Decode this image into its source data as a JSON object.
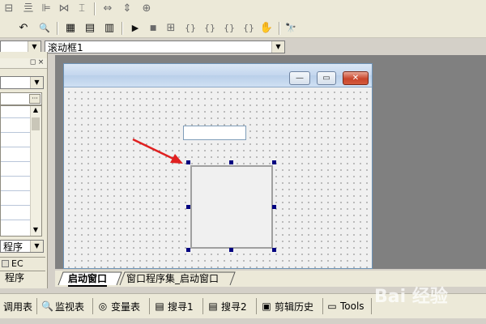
{
  "toolbar1": {
    "buttons": [
      {
        "name": "form-layout-icon",
        "glyph": "⊟"
      },
      {
        "name": "align-center-icon",
        "glyph": "亖"
      },
      {
        "name": "align-left-icon",
        "glyph": "⊫"
      },
      {
        "name": "equal-width-icon",
        "glyph": "⋈"
      },
      {
        "name": "equal-height-icon",
        "glyph": "⌶"
      },
      {
        "name": "space-horizontal-icon",
        "glyph": "⇔"
      },
      {
        "name": "space-vertical-icon",
        "glyph": "⇕"
      },
      {
        "name": "center-form-icon",
        "glyph": "⊕"
      }
    ]
  },
  "toolbar2": {
    "buttons": [
      {
        "name": "undo-icon",
        "glyph": "↶"
      },
      {
        "name": "find-icon",
        "glyph": "🔍"
      },
      {
        "name": "layout-icon-1",
        "glyph": "▦"
      },
      {
        "name": "layout-icon-2",
        "glyph": "▤"
      },
      {
        "name": "layout-icon-3",
        "glyph": "▥"
      },
      {
        "name": "run-icon",
        "glyph": "▶"
      },
      {
        "name": "stop-icon",
        "glyph": "■"
      },
      {
        "name": "compile-icon",
        "glyph": "⊞"
      },
      {
        "name": "step-into-icon",
        "glyph": "{}"
      },
      {
        "name": "step-over-icon",
        "glyph": "{}"
      },
      {
        "name": "step-out-icon",
        "glyph": "{}"
      },
      {
        "name": "run-to-cursor-icon",
        "glyph": "{}"
      },
      {
        "name": "hand-icon",
        "glyph": "✋"
      },
      {
        "name": "binoculars-icon",
        "glyph": "🔭"
      }
    ]
  },
  "selector": {
    "value": "滚动框1"
  },
  "leftpanel": {
    "dropdown_value": "程序",
    "tab1": "EC",
    "tab2": "程序",
    "ellipsis": "···",
    "pin": "◻",
    "close": "×"
  },
  "designer": {
    "window_buttons": {
      "min": "—",
      "max": "▭",
      "close": "✕"
    }
  },
  "tabs": [
    {
      "label": "启动窗口"
    },
    {
      "label": "窗口程序集_启动窗口"
    }
  ],
  "bottom_tabs": [
    {
      "label": "调用表",
      "icon": "call-table-icon",
      "glyph": ""
    },
    {
      "label": "监视表",
      "icon": "magnifier-icon",
      "glyph": "🔍"
    },
    {
      "label": "变量表",
      "icon": "glasses-icon",
      "glyph": "◎"
    },
    {
      "label": "搜寻1",
      "icon": "search-list-icon",
      "glyph": "▤"
    },
    {
      "label": "搜寻2",
      "icon": "search-list-icon",
      "glyph": "▤"
    },
    {
      "label": "剪辑历史",
      "icon": "clip-history-icon",
      "glyph": "▣"
    },
    {
      "label": "Tools",
      "icon": "tools-window-icon",
      "glyph": "▭"
    }
  ],
  "watermark": {
    "text": "Bai 经验"
  }
}
